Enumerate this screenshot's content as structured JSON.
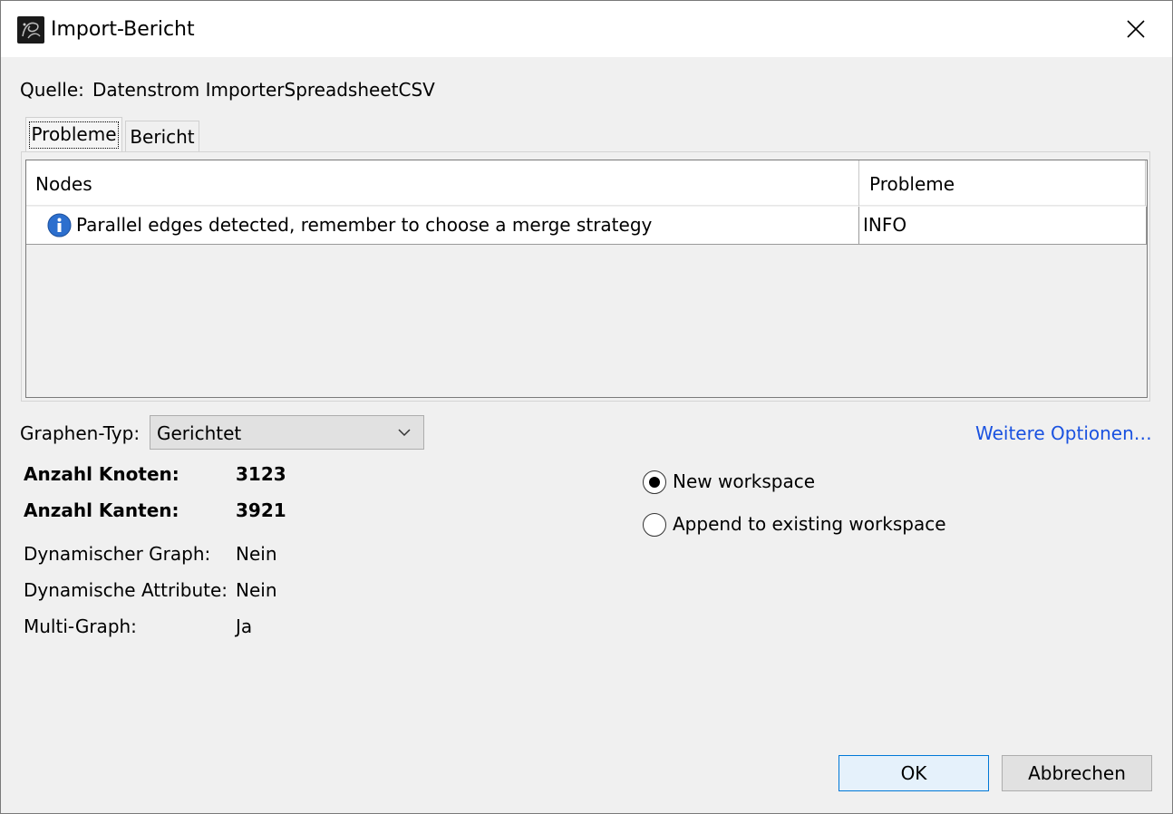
{
  "window": {
    "title": "Import-Bericht",
    "app_icon": "gephi-app-icon",
    "close_icon": "close-icon"
  },
  "source": {
    "label": "Quelle:",
    "value": "Datenstrom ImporterSpreadsheetCSV"
  },
  "tabs": [
    {
      "label": "Probleme",
      "active": true
    },
    {
      "label": "Bericht",
      "active": false
    }
  ],
  "issues_table": {
    "columns": [
      "Nodes",
      "Probleme"
    ],
    "rows": [
      {
        "icon": "info-icon",
        "message": "Parallel edges detected, remember to choose a merge strategy",
        "level": "INFO"
      }
    ]
  },
  "graph_type": {
    "label": "Graphen-Typ:",
    "selected": "Gerichtet"
  },
  "more_options_link": "Weitere Optionen…",
  "stats": [
    {
      "label": "Anzahl Knoten:",
      "value": "3123",
      "bold": true
    },
    {
      "label": "Anzahl Kanten:",
      "value": "3921",
      "bold": true
    },
    {
      "label": "Dynamischer Graph:",
      "value": "Nein",
      "bold": false
    },
    {
      "label": "Dynamische Attribute:",
      "value": "Nein",
      "bold": false
    },
    {
      "label": "Multi-Graph:",
      "value": "Ja",
      "bold": false
    }
  ],
  "workspace_options": [
    {
      "label": "New workspace",
      "selected": true
    },
    {
      "label": "Append to existing workspace",
      "selected": false
    }
  ],
  "buttons": {
    "ok": "OK",
    "cancel": "Abbrechen"
  },
  "colors": {
    "link": "#1a52e0",
    "info_icon": "#2c6fce",
    "ok_border": "#0078d7"
  }
}
